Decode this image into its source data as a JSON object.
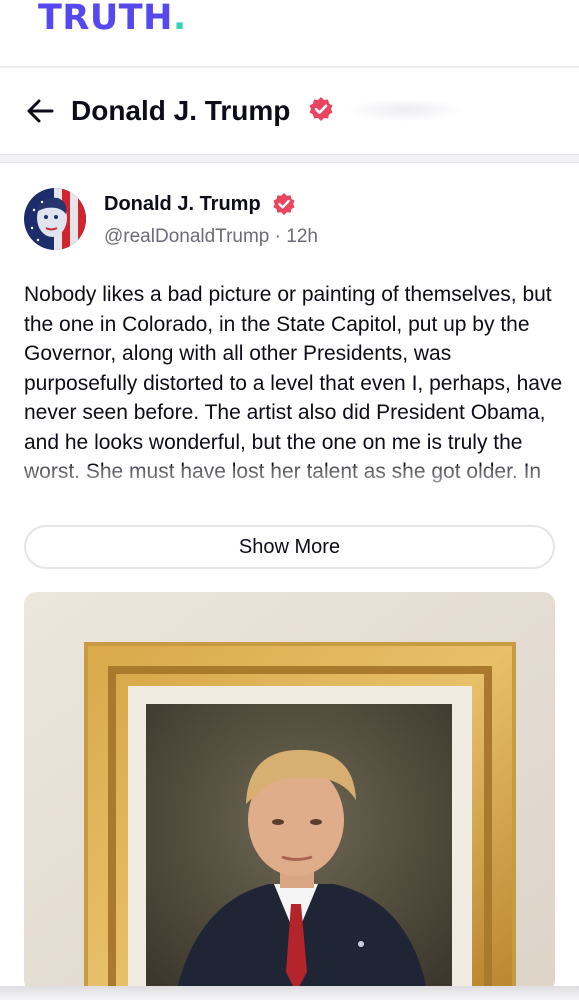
{
  "brand": {
    "logo_text": "TRUTH",
    "logo_dot": ".",
    "logo_color": "#5448ee",
    "dot_color": "#34d2b3"
  },
  "profile_header": {
    "back_icon": "arrow-left-icon",
    "title": "Donald J. Trump",
    "verified_icon": "verified-badge-icon",
    "verified_color": "#e8465f"
  },
  "post": {
    "author_name": "Donald J. Trump",
    "author_meta": "@realDonaldTrump · 12h",
    "avatar_icon": "avatar-flag-face",
    "text": "Nobody likes a bad picture or painting of themselves, but the one in Colorado, in the State Capitol, put up by the Governor, along with all other Presidents, was purposefully distorted to a level that even I, perhaps, have never seen before. The artist also did President Obama, and he looks wonderful, but the one on me is truly the worst. She must have lost her talent as she got older. In",
    "show_more_label": "Show More",
    "media_icon": "framed-portrait-image"
  }
}
